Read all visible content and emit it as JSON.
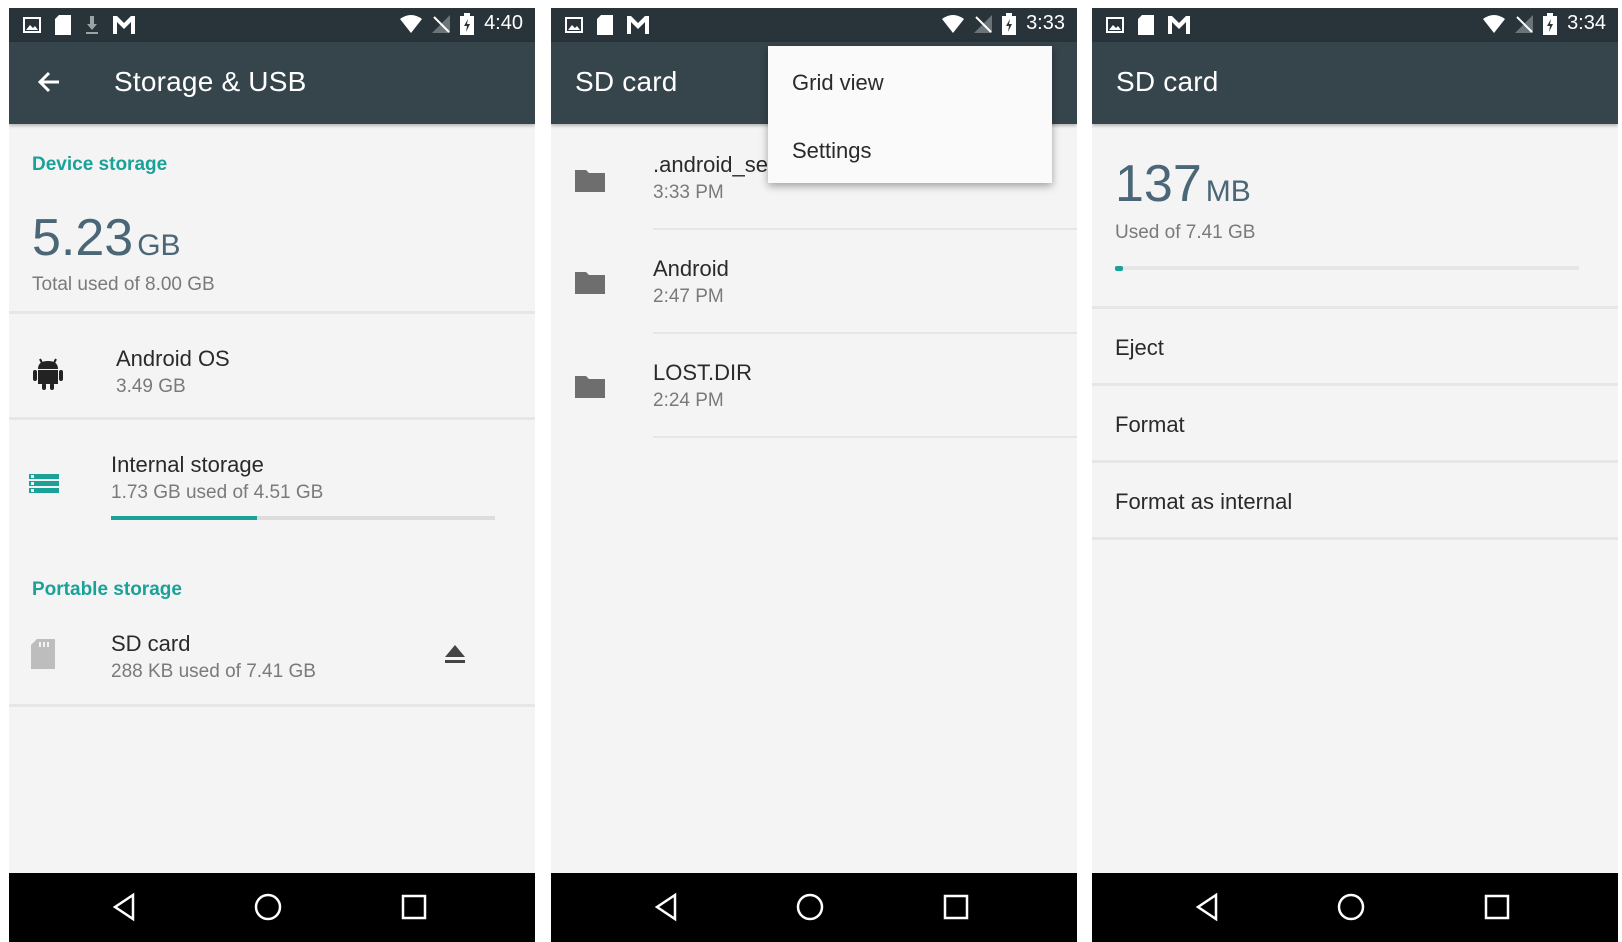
{
  "colors": {
    "accent": "#1aa198",
    "appbar": "#36444c",
    "statusbar": "#28333a",
    "navbar": "#000000",
    "big_number": "#4a6677"
  },
  "screens": [
    {
      "status": {
        "time": "4:40"
      },
      "appbar": {
        "title": "Storage & USB"
      },
      "device_storage": {
        "header": "Device storage",
        "used_value": "5.23",
        "used_unit": "GB",
        "subtitle": "Total used of 8.00 GB",
        "items": [
          {
            "icon": "android-icon",
            "title": "Android OS",
            "subtitle": "3.49 GB"
          },
          {
            "icon": "storage-icon",
            "title": "Internal storage",
            "subtitle": "1.73 GB used of 4.51 GB",
            "progress": 0.38
          }
        ]
      },
      "portable_storage": {
        "header": "Portable storage",
        "items": [
          {
            "icon": "sd-card-icon",
            "title": "SD card",
            "subtitle": "288 KB used of 7.41 GB",
            "action_icon": "eject-icon"
          }
        ]
      }
    },
    {
      "status": {
        "time": "3:33"
      },
      "appbar": {
        "title": "SD card"
      },
      "menu": {
        "items": [
          "Grid view",
          "Settings"
        ]
      },
      "files": [
        {
          "icon": "folder-icon",
          "name": ".android_sec",
          "time": "3:33 PM"
        },
        {
          "icon": "folder-icon",
          "name": "Android",
          "time": "2:47 PM"
        },
        {
          "icon": "folder-icon",
          "name": "LOST.DIR",
          "time": "2:24 PM"
        }
      ]
    },
    {
      "status": {
        "time": "3:34"
      },
      "appbar": {
        "title": "SD card"
      },
      "usage": {
        "used_value": "137",
        "used_unit": "MB",
        "subtitle": "Used of 7.41 GB",
        "progress": 0.018
      },
      "actions": [
        "Eject",
        "Format",
        "Format as internal"
      ]
    }
  ]
}
